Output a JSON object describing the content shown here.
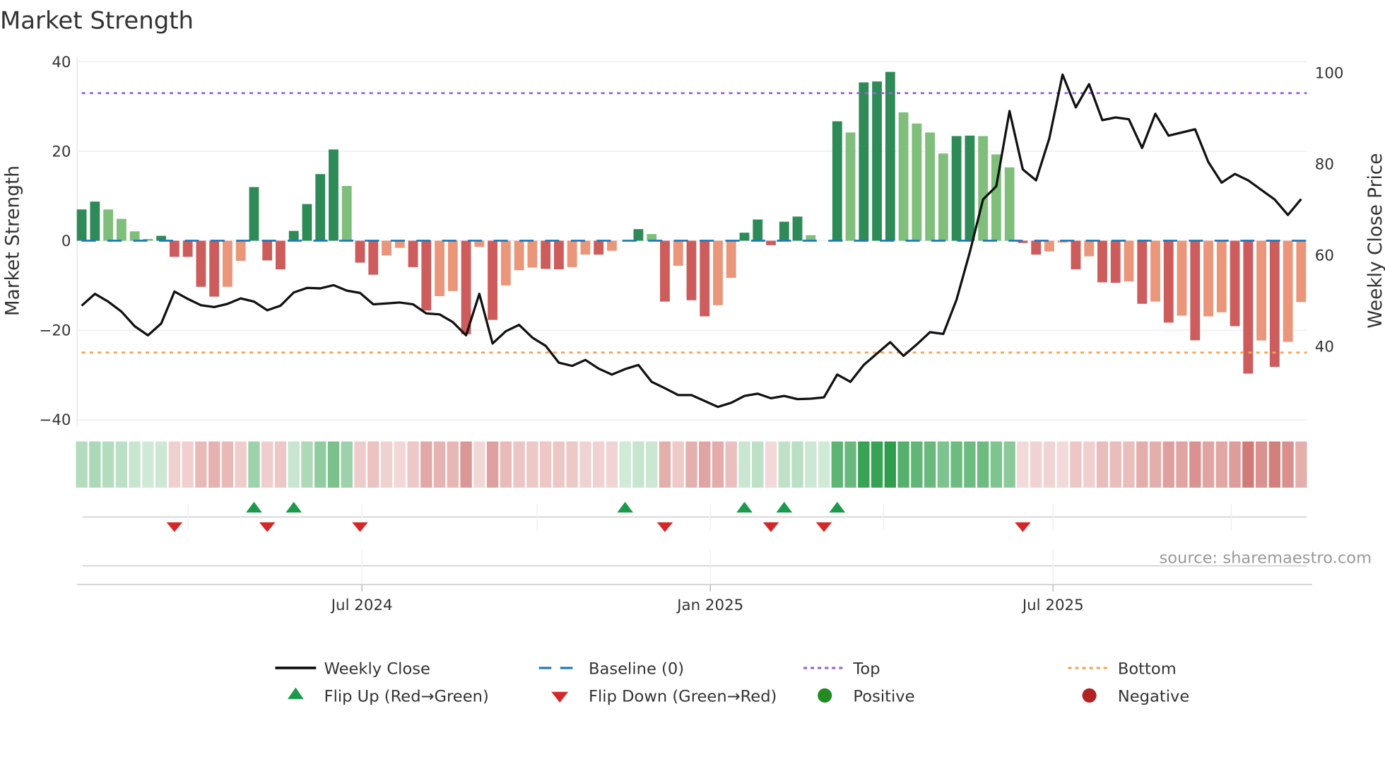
{
  "chart_data": {
    "type": "bar",
    "title": "Market Strength",
    "interval": "weekly",
    "x_start": "2024-02-04",
    "strength": [
      7.0,
      8.75,
      7.0,
      4.9,
      2.1,
      0.4,
      1.1,
      -3.6,
      -3.6,
      -10.3,
      -12.5,
      -10.3,
      -4.5,
      12.0,
      -4.4,
      -6.4,
      2.2,
      8.2,
      14.9,
      20.4,
      12.25,
      -4.9,
      -7.6,
      -3.3,
      -1.6,
      -5.9,
      -15.6,
      -12.4,
      -11.25,
      -20.9,
      -1.4,
      -17.7,
      -10.0,
      -6.6,
      -6.0,
      -6.3,
      -6.4,
      -5.9,
      -3.1,
      -3.1,
      -2.25,
      0,
      2.6,
      1.5,
      -13.6,
      -5.6,
      -13.3,
      -16.9,
      -14.4,
      -8.3,
      1.8,
      4.75,
      -1.0,
      4.25,
      5.4,
      1.25,
      0,
      26.7,
      24.2,
      35.4,
      35.6,
      37.75,
      28.7,
      26.2,
      24.2,
      19.5,
      23.4,
      23.5,
      23.4,
      19.3,
      16.4,
      -0.5,
      -3.1,
      -2.4,
      -0.4,
      -6.4,
      -3.5,
      -9.3,
      -9.4,
      -9.1,
      -14.1,
      -13.6,
      -18.3,
      -16.75,
      -22.25,
      -16.9,
      -16.0,
      -19.1,
      -29.7,
      -22.3,
      -28.2,
      -22.6,
      -13.7
    ],
    "weekly_close": [
      48.9,
      51.5,
      49.8,
      47.6,
      44.4,
      42.4,
      45.0,
      52.0,
      50.4,
      49.0,
      48.6,
      49.3,
      50.5,
      49.8,
      47.9,
      48.9,
      51.8,
      52.8,
      52.7,
      53.4,
      52.2,
      51.7,
      49.2,
      49.4,
      49.6,
      49.2,
      47.2,
      47.0,
      45.3,
      42.4,
      51.5,
      40.6,
      43.3,
      44.7,
      41.9,
      40.1,
      36.4,
      35.7,
      37.0,
      35.1,
      33.8,
      35.0,
      35.9,
      32.2,
      30.8,
      29.3,
      29.3,
      28.0,
      26.7,
      27.6,
      29.1,
      29.6,
      28.6,
      29.1,
      28.4,
      28.5,
      28.8,
      33.8,
      32.2,
      35.9,
      38.4,
      40.9,
      37.9,
      40.4,
      43.1,
      42.7,
      50.2,
      60.6,
      72.2,
      75.1,
      91.6,
      78.8,
      76.4,
      85.6,
      99.6,
      92.4,
      97.5,
      89.6,
      90.2,
      89.8,
      83.5,
      91.0,
      86.2,
      86.9,
      87.6,
      80.4,
      75.9,
      77.8,
      76.4,
      74.3,
      72.2,
      68.8,
      72.3
    ],
    "top": 33,
    "bottom": -25,
    "baseline": 0,
    "flip_up_weeks": [
      13,
      16,
      41,
      50,
      53,
      57
    ],
    "flip_down_weeks": [
      7,
      14,
      21,
      44,
      52,
      56,
      71
    ],
    "y_left": {
      "label": "Market Strength",
      "ticks": [
        40,
        20,
        0,
        -20,
        -40
      ],
      "tick_labels": [
        "40",
        "20",
        "0",
        "−20",
        "−40"
      ],
      "range": [
        -40.3,
        40.3
      ]
    },
    "y_right": {
      "label": "Weekly Close Price",
      "ticks": [
        100,
        80,
        60,
        40
      ],
      "tick_labels": [
        "100",
        "80",
        "60",
        "40"
      ],
      "range": [
        23.6,
        102.7
      ]
    },
    "x_ticks": [
      {
        "label": "Jul 2024",
        "date": "2024-07-01"
      },
      {
        "label": "Jan 2025",
        "date": "2025-01-01"
      },
      {
        "label": "Jul 2025",
        "date": "2025-07-01"
      }
    ],
    "grid": true,
    "legend_position": "bottom",
    "colors": {
      "pos_strong": "#2e8b57",
      "pos_weak": "#7fbf7b",
      "neg_strong": "#cd5c5c",
      "neg_weak": "#e9967a",
      "line": "#111111",
      "baseline": "#1f77b4",
      "top": "#9b5fd6",
      "bottom": "#f0a35e",
      "flip_up": "#1a9a4a",
      "flip_down": "#d62728",
      "positive": "#228b22",
      "negative": "#b22222",
      "heat_pos": "#2f9e4c",
      "heat_neg": "#c85f5c"
    }
  },
  "legend": {
    "weekly_close": "Weekly Close",
    "baseline": "Baseline (0)",
    "top": "Top",
    "bottom": "Bottom",
    "flip_up": "Flip Up (Red→Green)",
    "flip_down": "Flip Down (Green→Red)",
    "positive": "Positive",
    "negative": "Negative"
  },
  "source": "source: sharemaestro.com"
}
